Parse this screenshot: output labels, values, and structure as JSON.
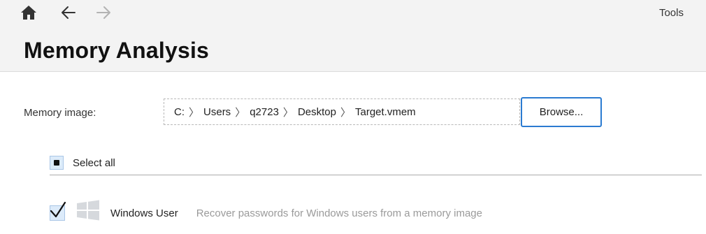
{
  "header": {
    "tools_label": "Tools",
    "title": "Memory Analysis",
    "nav": [
      {
        "name": "home",
        "icon": "home-icon",
        "enabled": true
      },
      {
        "name": "back",
        "icon": "arrow-left-icon",
        "enabled": true
      },
      {
        "name": "forward",
        "icon": "arrow-right-icon",
        "enabled": false
      }
    ]
  },
  "memory_image": {
    "label": "Memory image:",
    "path": [
      "C:",
      "Users",
      "q2723",
      "Desktop",
      "Target.vmem"
    ],
    "path_separator": "〉",
    "browse_label": "Browse..."
  },
  "selection": {
    "select_all_label": "Select all",
    "select_all_state": "indeterminate"
  },
  "modules": [
    {
      "name": "Windows User",
      "description": "Recover passwords for Windows users from a memory image",
      "icon": "windows-logo-icon",
      "checked": true
    }
  ],
  "colors": {
    "accent": "#2b7bd1",
    "checkbox_fill": "#dcebfa",
    "header_bg": "#f3f3f3",
    "muted_text": "#9a9a9a"
  }
}
